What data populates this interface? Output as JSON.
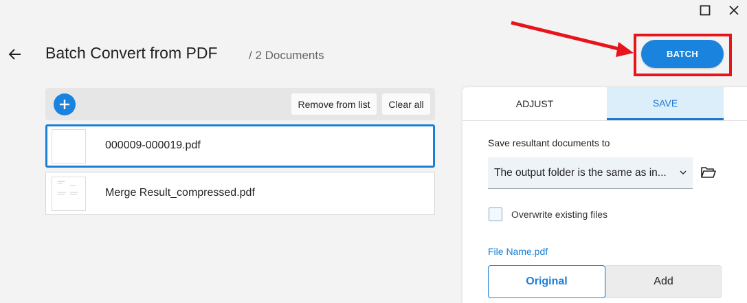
{
  "window": {
    "maximize_icon": "maximize-icon",
    "close_icon": "close-icon"
  },
  "header": {
    "back_icon": "arrow-left-icon",
    "title": "Batch Convert from PDF",
    "subtitle": "/ 2 Documents",
    "batch_label": "BATCH",
    "annotation_color": "#e8141c"
  },
  "toolbar": {
    "add_icon": "plus-icon",
    "remove_label": "Remove from list",
    "clear_label": "Clear all"
  },
  "files": [
    {
      "name": "000009-000019.pdf",
      "selected": true
    },
    {
      "name": "Merge Result_compressed.pdf",
      "selected": false
    }
  ],
  "panel": {
    "tabs": [
      {
        "label": "ADJUST",
        "active": false
      },
      {
        "label": "SAVE",
        "active": true
      }
    ],
    "save_to_label": "Save resultant documents to",
    "save_to_value": "The output folder is the same as in...",
    "folder_icon": "folder-open-icon",
    "overwrite_label": "Overwrite existing files",
    "overwrite_checked": false,
    "file_name_label": "File Name.pdf",
    "name_options": [
      {
        "label": "Original",
        "active": true
      },
      {
        "label": "Add",
        "active": false
      }
    ]
  },
  "colors": {
    "accent": "#1a83de",
    "annotation": "#e8141c",
    "background": "#f3f3f3"
  }
}
